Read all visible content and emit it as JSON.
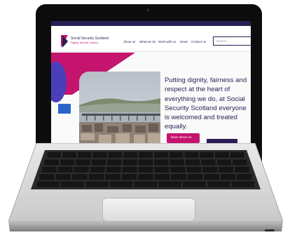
{
  "site": {
    "brand": "Social Security Scotland",
    "tagline": "Dignity, fairness, respect.",
    "nav": [
      "About us",
      "What we do",
      "Work with us",
      "News",
      "Contact us"
    ],
    "search_placeholder": "Search",
    "headline": "Putting dignity, fairness and respect at the heart of everything we do, at Social Security Scotland everyone is welcomed and treated equally.",
    "cta_label": "More about us"
  },
  "colors": {
    "brand_navy": "#2b1d54",
    "brand_pink": "#c4146e",
    "brand_blue": "#2c63c9"
  },
  "icons": {
    "logo": "social-security-scotland-logo-icon",
    "camera": "webcam-icon"
  }
}
